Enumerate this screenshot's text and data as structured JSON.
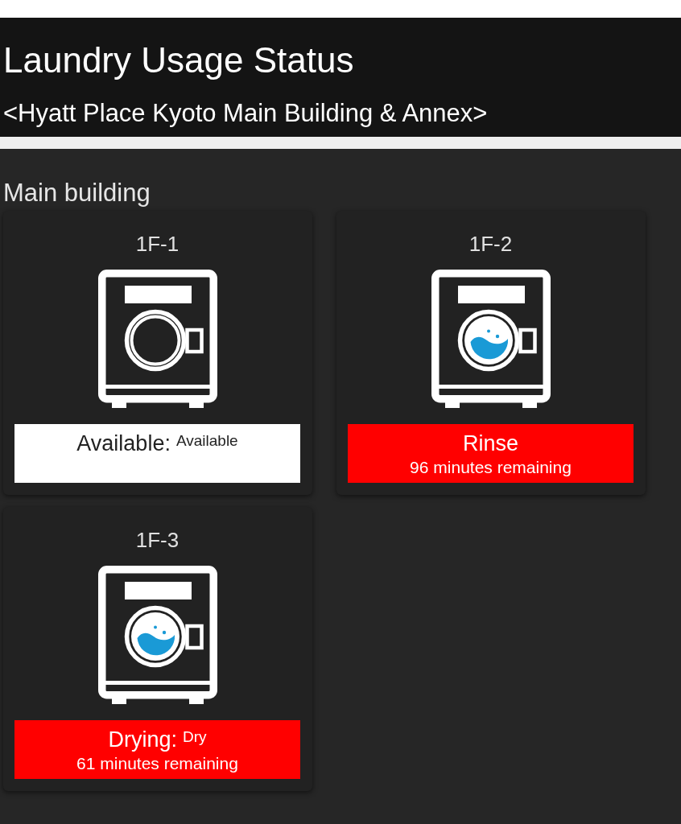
{
  "header": {
    "title": "Laundry Usage Status",
    "subtitle": "<Hyatt Place Kyoto Main Building & Annex>"
  },
  "sections": [
    {
      "title": "Main building",
      "machines": [
        {
          "name": "1F-1",
          "in_use": false,
          "status": "Available:",
          "detail": "Available"
        },
        {
          "name": "1F-2",
          "in_use": true,
          "status": "Rinse",
          "remaining": "96 minutes remaining"
        },
        {
          "name": "1F-3",
          "in_use": true,
          "status": "Drying:",
          "detail": "Dry",
          "remaining": "61 minutes remaining"
        }
      ]
    }
  ]
}
